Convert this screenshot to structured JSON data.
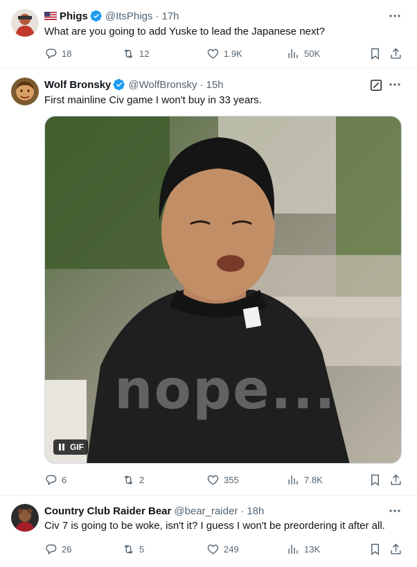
{
  "tweets": [
    {
      "name": "Phigs",
      "handle": "@ItsPhigs",
      "time": "17h",
      "text": "What are you going to add Yuske to lead the Japanese next?",
      "replies": "18",
      "retweets": "12",
      "likes": "1.9K",
      "views": "50K"
    },
    {
      "name": "Wolf Bronsky",
      "handle": "@WolfBronsky",
      "time": "15h",
      "text": "First mainline Civ game I won't buy in 33 years.",
      "replies": "6",
      "retweets": "2",
      "likes": "355",
      "views": "7.8K",
      "media": {
        "gif_label": "GIF",
        "caption": "nope..."
      }
    },
    {
      "name": "Country Club Raider Bear",
      "handle": "@bear_raider",
      "time": "18h",
      "text": "Civ 7 is going to be woke, isn't it? I guess I won't be preordering it after all.",
      "replies": "26",
      "retweets": "5",
      "likes": "249",
      "views": "13K"
    }
  ],
  "separator": "·",
  "colors": {
    "verified": "#1d9bf0",
    "muted": "#536471",
    "text": "#0f1419",
    "divider": "#eff3f4"
  },
  "icons": [
    "reply-icon",
    "retweet-icon",
    "like-icon",
    "views-icon",
    "bookmark-icon",
    "share-icon",
    "more-icon",
    "verified-icon",
    "edited-icon",
    "pause-icon",
    "flag-us-icon"
  ]
}
